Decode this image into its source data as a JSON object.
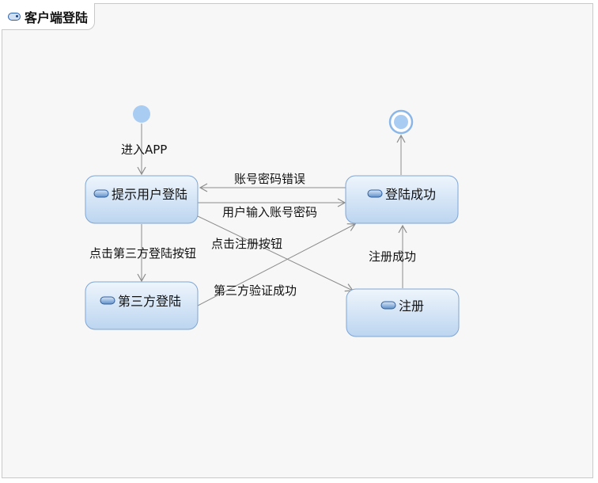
{
  "title": "客户端登陆",
  "states": {
    "prompt_login": "提示用户登陆",
    "login_success": "登陆成功",
    "third_party_login": "第三方登陆",
    "register": "注册"
  },
  "transitions": {
    "enter_app": "进入APP",
    "wrong_password": "账号密码错误",
    "input_password": "用户输入账号密码",
    "click_third_party": "点击第三方登陆按钮",
    "click_register": "点击注册按钮",
    "third_party_verified": "第三方验证成功",
    "register_success": "注册成功"
  },
  "colors": {
    "state_fill_top": "#eaf2fb",
    "state_fill_bottom": "#bcd6f1",
    "state_border": "#7fa6d4",
    "initial_node": "#a9ccf3",
    "edge": "#8c8c8c"
  },
  "icons": {
    "state": "state-icon",
    "diagram": "state-diagram-icon"
  }
}
